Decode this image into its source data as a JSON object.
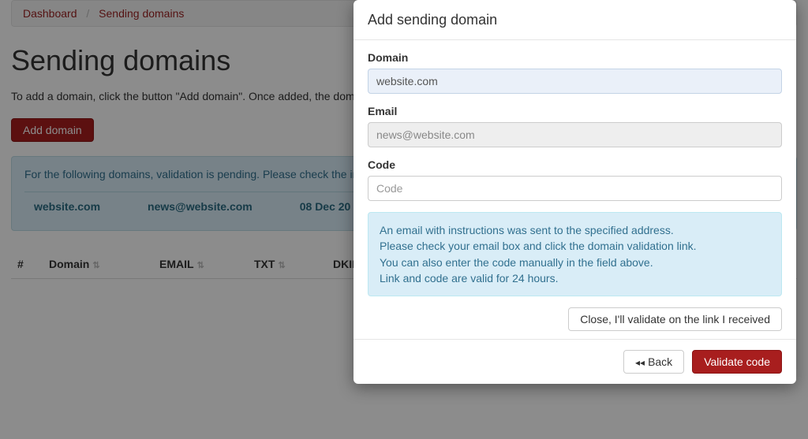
{
  "breadcrumb": {
    "items": [
      "Dashboard",
      "Sending domains"
    ]
  },
  "page": {
    "title": "Sending domains",
    "intro": "To add a domain, click the button \"Add domain\". Once added, the domain",
    "add_domain_btn": "Add domain"
  },
  "pending_alert": {
    "message": "For the following domains, validation is pending. Please check the incoming",
    "row": {
      "domain": "website.com",
      "email": "news@website.com",
      "date": "08 Dec 20"
    }
  },
  "table": {
    "headers": {
      "num": "#",
      "domain": "Domain",
      "email": "EMAIL",
      "txt": "TXT",
      "dkim": "DKIM"
    }
  },
  "modal": {
    "title": "Add sending domain",
    "domain_label": "Domain",
    "domain_value": "website.com",
    "email_label": "Email",
    "email_value": "news@website.com",
    "code_label": "Code",
    "code_placeholder": "Code",
    "info": {
      "line1": "An email with instructions was sent to the specified address.",
      "line2": "Please check your email box and click the domain validation link.",
      "line3": "You can also enter the code manually in the field above.",
      "line4": "Link and code are valid for 24 hours."
    },
    "close_link_btn": "Close, I'll validate on the link I received",
    "back_btn": "Back",
    "validate_btn": "Validate code"
  }
}
